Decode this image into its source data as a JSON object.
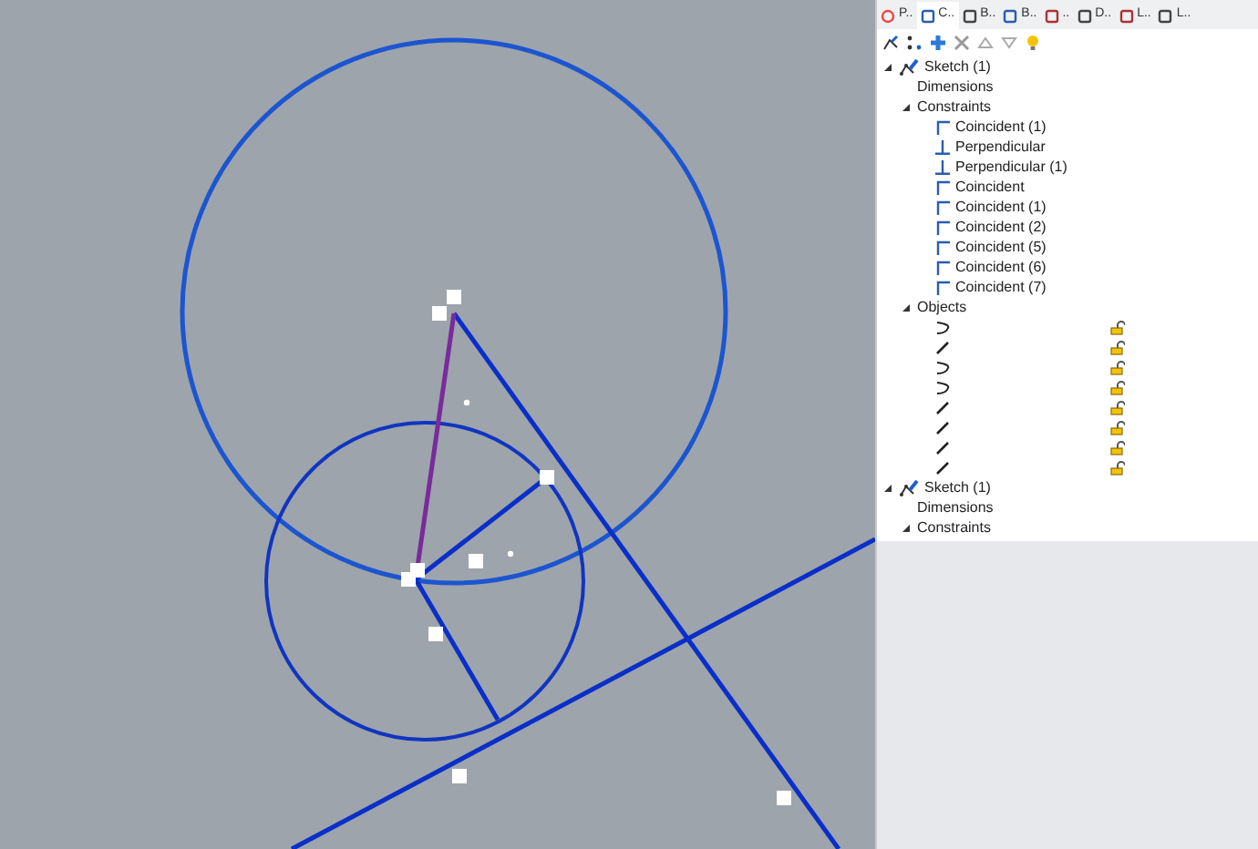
{
  "tabs": [
    {
      "label": "P..",
      "selected": false
    },
    {
      "label": "C..",
      "selected": true
    },
    {
      "label": "B..",
      "selected": false
    },
    {
      "label": "B..",
      "selected": false
    },
    {
      "label": "..",
      "selected": false
    },
    {
      "label": "D..",
      "selected": false
    },
    {
      "label": "L..",
      "selected": false
    },
    {
      "label": "L..",
      "selected": false
    }
  ],
  "tree": [
    {
      "kind": "sketch",
      "label": "Sketch (1)",
      "expanded": true,
      "children": [
        {
          "label": "Dimensions"
        },
        {
          "label": "Constraints",
          "expanded": true,
          "children": [
            {
              "kind": "coincident",
              "label": "Coincident (1)"
            },
            {
              "kind": "perpendicular",
              "label": "Perpendicular"
            },
            {
              "kind": "perpendicular",
              "label": "Perpendicular (1)"
            },
            {
              "kind": "coincident",
              "label": "Coincident"
            },
            {
              "kind": "coincident",
              "label": "Coincident (1)"
            },
            {
              "kind": "coincident",
              "label": "Coincident (2)"
            },
            {
              "kind": "coincident",
              "label": "Coincident (5)"
            },
            {
              "kind": "coincident",
              "label": "Coincident (6)"
            },
            {
              "kind": "coincident",
              "label": "Coincident (7)"
            }
          ]
        },
        {
          "label": "Objects",
          "expanded": true,
          "children": [
            {
              "kind": "arc",
              "locked": false
            },
            {
              "kind": "line",
              "locked": false
            },
            {
              "kind": "arc",
              "locked": false
            },
            {
              "kind": "arc",
              "locked": false
            },
            {
              "kind": "line",
              "locked": false
            },
            {
              "kind": "line",
              "locked": false
            },
            {
              "kind": "line",
              "locked": false
            },
            {
              "kind": "line",
              "locked": false
            }
          ]
        }
      ]
    },
    {
      "kind": "sketch",
      "label": "Sketch (1)",
      "expanded": true,
      "children": [
        {
          "label": "Dimensions"
        },
        {
          "label": "Constraints",
          "expanded": true
        }
      ]
    }
  ]
}
